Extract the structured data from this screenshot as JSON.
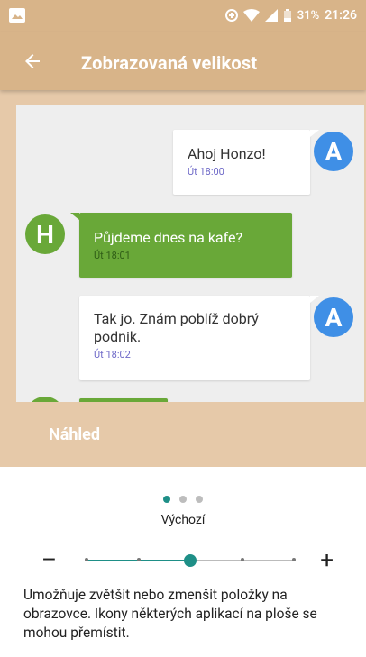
{
  "status_bar": {
    "battery_percent": "31%",
    "time": "21:26"
  },
  "app_bar": {
    "title": "Zobrazovaná velikost"
  },
  "preview": {
    "label": "Náhled",
    "messages": [
      {
        "avatar": "A",
        "text": "Ahoj Honzo!",
        "time": "Út 18:00"
      },
      {
        "avatar": "H",
        "text": "Půjdeme dnes na kafe?",
        "time": "Út 18:01"
      },
      {
        "avatar": "A",
        "text": "Tak jo. Znám poblíž dobrý podnik.",
        "time": "Út 18:02"
      }
    ]
  },
  "size_control": {
    "current_label": "Výchozí",
    "minus": "–",
    "plus": "+",
    "level_index": 2,
    "levels": 5
  },
  "description": "Umožňuje zvětšit nebo zmenšit položky na obrazovce. Ikony některých aplikací na ploše se mohou přemístit.",
  "colors": {
    "accent": "#1e8f87",
    "app_bar": "#d8b489",
    "avatar_a": "#3f8fe6",
    "avatar_h": "#69a838"
  }
}
